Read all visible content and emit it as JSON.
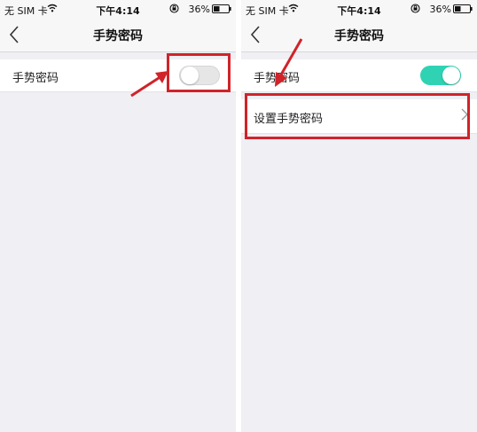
{
  "screens": [
    {
      "status_bar": {
        "carrier": "无 SIM 卡",
        "time": "下午4:14",
        "battery_pct": "36%"
      },
      "nav": {
        "title": "手势密码"
      },
      "gesture_row": {
        "label": "手势密码",
        "toggle": "off"
      }
    },
    {
      "status_bar": {
        "carrier": "无 SIM 卡",
        "time": "下午4:14",
        "battery_pct": "36%"
      },
      "nav": {
        "title": "手势密码"
      },
      "gesture_row": {
        "label": "手势密码",
        "toggle": "on"
      },
      "set_row": {
        "label": "设置手势密码"
      }
    }
  ],
  "colors": {
    "toggle_on": "#2fd3b4",
    "toggle_off": "#e6e6e6",
    "annotation": "#d0232a",
    "background": "#efeff4"
  },
  "icons": [
    "wifi-icon",
    "orientation-lock-icon",
    "battery-icon",
    "back-icon",
    "chevron-right-icon",
    "arrow-icon"
  ]
}
